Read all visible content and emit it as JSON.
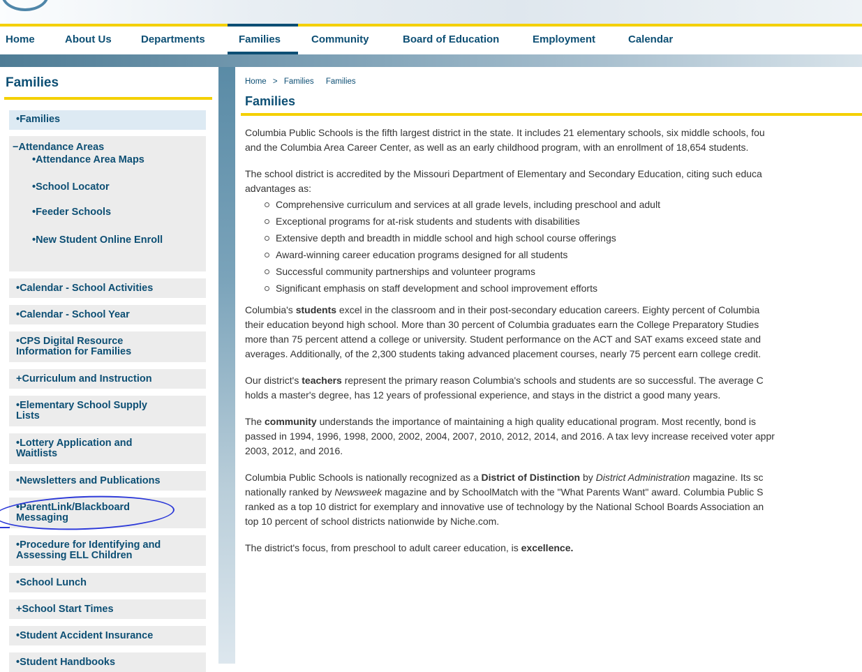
{
  "nav": {
    "items": [
      "Home",
      "About Us",
      "Departments",
      "Families",
      "Community",
      "Board of Education",
      "Employment",
      "Calendar"
    ],
    "active": "Families"
  },
  "sidebar": {
    "title": "Families",
    "items": [
      {
        "label": "•Families"
      },
      {
        "label": "−Attendance Areas"
      },
      {
        "label": "•Attendance Area Maps"
      },
      {
        "label": "•School Locator"
      },
      {
        "label": "•Feeder Schools"
      },
      {
        "label": "•New Student Online Enroll"
      },
      {
        "label": "•Calendar - School Activities"
      },
      {
        "label": "•Calendar - School Year"
      },
      {
        "label": "•CPS Digital Resource Information for Families"
      },
      {
        "label": "+Curriculum and Instruction"
      },
      {
        "label": "•Elementary School Supply Lists"
      },
      {
        "label": "•Lottery Application and Waitlists"
      },
      {
        "label": "•Newsletters and Publications"
      },
      {
        "label": "•ParentLink/Blackboard Messaging"
      },
      {
        "label": "•Procedure for Identifying and Assessing ELL Children"
      },
      {
        "label": "•School Lunch"
      },
      {
        "label": "+School Start Times"
      },
      {
        "label": "•Student Accident Insurance"
      },
      {
        "label": "•Student Handbooks"
      }
    ]
  },
  "breadcrumb": {
    "home": "Home",
    "sep": ">",
    "current": "Families",
    "extra": "Families"
  },
  "page_title": "Families",
  "content": {
    "p1": "Columbia Public Schools is the fifth largest district in the state. It includes 21 elementary schools, six middle schools, fou",
    "p1b": "and the Columbia Area Career Center, as well as an early childhood program, with an enrollment of 18,654 students.",
    "p2": "The school district is accredited by the Missouri Department of Elementary and Secondary Education, citing such educa",
    "p2b": "advantages as:",
    "bullets": [
      "Comprehensive curriculum and services at all grade levels, including preschool and adult",
      "Exceptional programs for at-risk students and students with disabilities",
      "Extensive depth and breadth in middle school and high school course offerings",
      "Award-winning career education programs designed for all students",
      "Successful community partnerships and volunteer programs",
      "Significant emphasis on staff development and school improvement efforts"
    ],
    "p3a": "Columbia's ",
    "p3bold": "students",
    "p3c": " excel in the classroom and in their post-secondary education careers. Eighty percent of Columbia",
    "p3l2": "their education beyond high school. More than 30 percent of Columbia graduates earn the College Preparatory Studies",
    "p3l3": "more than 75 percent attend a college or university. Student performance on the ACT and SAT exams exceed state and",
    "p3l4": "averages. Additionally, of the 2,300 students taking advanced placement courses, nearly 75 percent earn college credit.",
    "p4a": "Our district's ",
    "p4bold": "teachers",
    "p4c": " represent the primary reason Columbia's schools and students are so successful. The average C",
    "p4l2": "holds a master's degree, has 12 years of professional experience, and stays in the district a good many years.",
    "p5a": "The ",
    "p5bold": "community",
    "p5c": " understands the importance of maintaining a high quality educational program. Most recently, bond is",
    "p5l2": "passed in 1994, 1996, 1998, 2000, 2002, 2004, 2007, 2010, 2012, 2014, and 2016. A tax levy increase received voter appr",
    "p5l3": "2003, 2012, and 2016.",
    "p6a": "Columbia Public Schools is nationally recognized as a ",
    "p6bold": "District of Distinction",
    "p6b": " by ",
    "p6italic": "District Administration",
    "p6c": " magazine. Its sc",
    "p6l2a": "nationally ranked by ",
    "p6l2italic": "Newsweek",
    "p6l2c": " magazine and by SchoolMatch with the \"What Parents Want\" award. Columbia Public S",
    "p6l3": "ranked as a top 10 district for exemplary and innovative use of technology by the National School Boards Association an",
    "p6l4": "top 10 percent of school districts nationwide by Niche.com.",
    "p7a": "The district's focus, from preschool to adult career education, is ",
    "p7bold": "excellence."
  }
}
